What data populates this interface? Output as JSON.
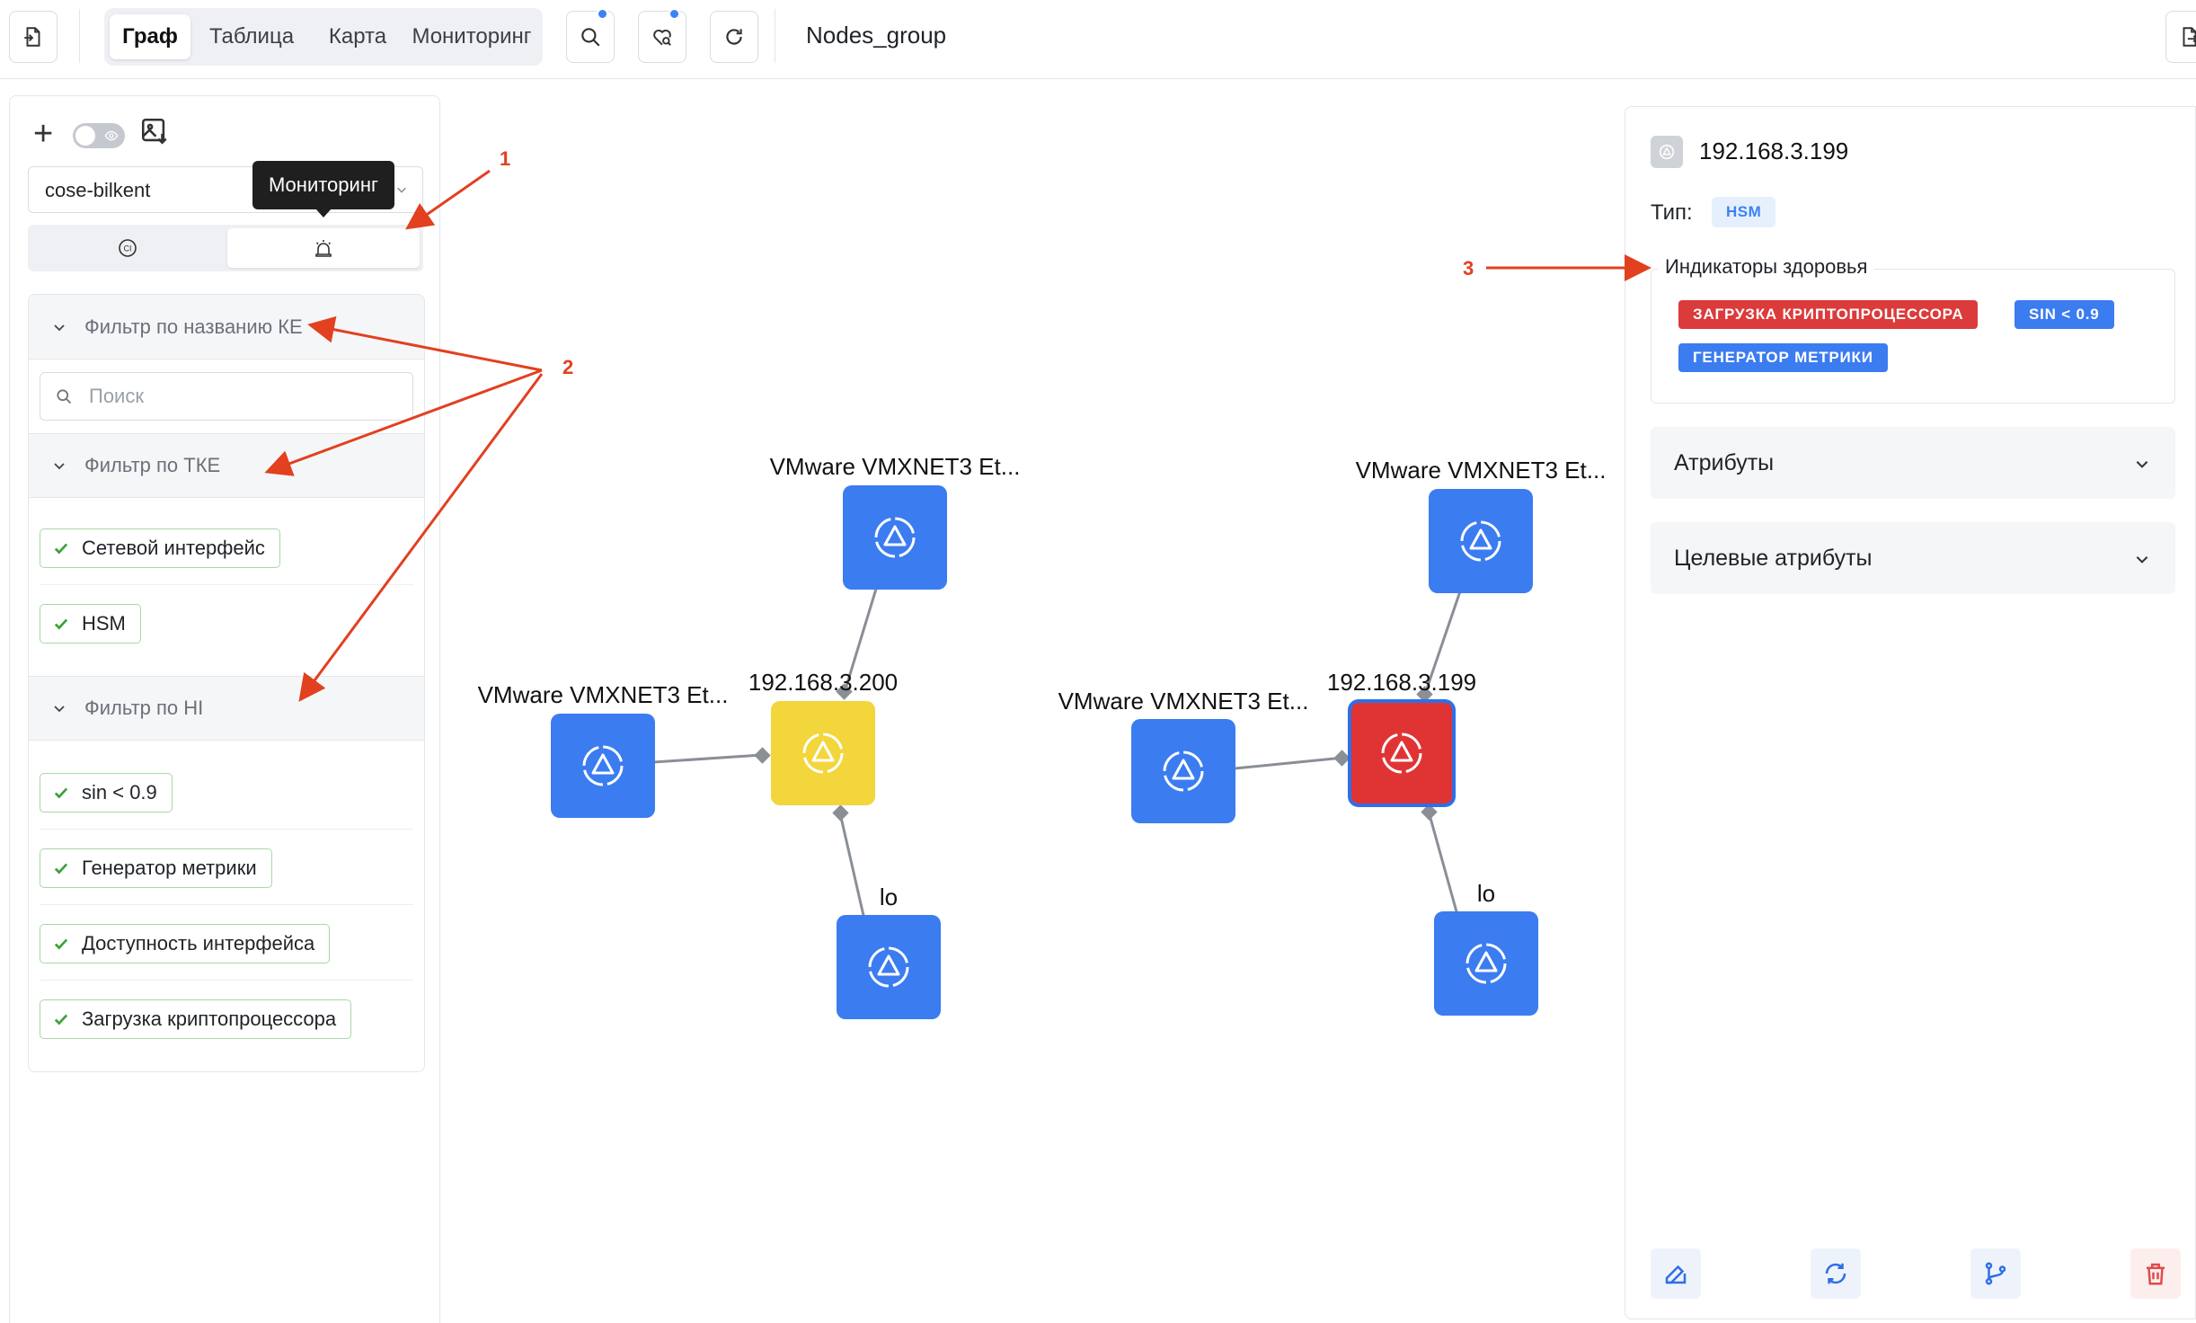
{
  "topbar": {
    "tabs": [
      {
        "label": "Граф",
        "active": true
      },
      {
        "label": "Таблица",
        "active": false
      },
      {
        "label": "Карта",
        "active": false
      },
      {
        "label": "Мониторинг",
        "active": false
      }
    ],
    "title": "Nodes_group",
    "icons": [
      "import-file-icon",
      "search-icon",
      "heart-search-icon",
      "refresh-icon",
      "export-file-icon"
    ]
  },
  "left_panel": {
    "layout_select": "cose-bilkent",
    "tooltip": "Мониторинг",
    "tabs": [
      "ci-icon",
      "alarm-icon"
    ],
    "filters": {
      "ke": {
        "title": "Фильтр по названию КЕ",
        "search_placeholder": "Поиск"
      },
      "tke": {
        "title": "Фильтр по ТКЕ",
        "items": [
          "Сетевой интерфейс",
          "HSM"
        ]
      },
      "hi": {
        "title": "Фильтр по HI",
        "items": [
          "sin < 0.9",
          "Генератор метрики",
          "Доступность интерфейса",
          "Загрузка криптопроцессора"
        ]
      }
    }
  },
  "graph": {
    "groups": [
      {
        "center": {
          "label": "192.168.3.200",
          "status": "warning",
          "color": "#f2d63c"
        },
        "top": {
          "label": "VMware VMXNET3 Et..."
        },
        "left": {
          "label": "VMware VMXNET3 Et..."
        },
        "bottom": {
          "label": "lo"
        }
      },
      {
        "center": {
          "label": "192.168.3.199",
          "status": "critical",
          "color": "#e03434"
        },
        "top": {
          "label": "VMware VMXNET3 Et..."
        },
        "left": {
          "label": "VMware VMXNET3 Et..."
        },
        "bottom": {
          "label": "lo"
        }
      }
    ],
    "node_color": "#3b7cf0"
  },
  "right_panel": {
    "title": "192.168.3.199",
    "type_label": "Тип:",
    "type_value": "HSM",
    "health_title": "Индикаторы здоровья",
    "health_tags": [
      {
        "label": "ЗАГРУЗКА КРИПТОПРОЦЕССОРА",
        "color": "#dc3b3b"
      },
      {
        "label": "SIN < 0.9",
        "color": "#3b7cf0"
      },
      {
        "label": "ГЕНЕРАТОР МЕТРИКИ",
        "color": "#3b7cf0"
      }
    ],
    "sections": [
      "Атрибуты",
      "Целевые атрибуты"
    ],
    "actions": [
      "edit-icon",
      "sync-icon",
      "branch-icon",
      "trash-icon"
    ]
  },
  "annotations": [
    "1",
    "2",
    "3"
  ]
}
